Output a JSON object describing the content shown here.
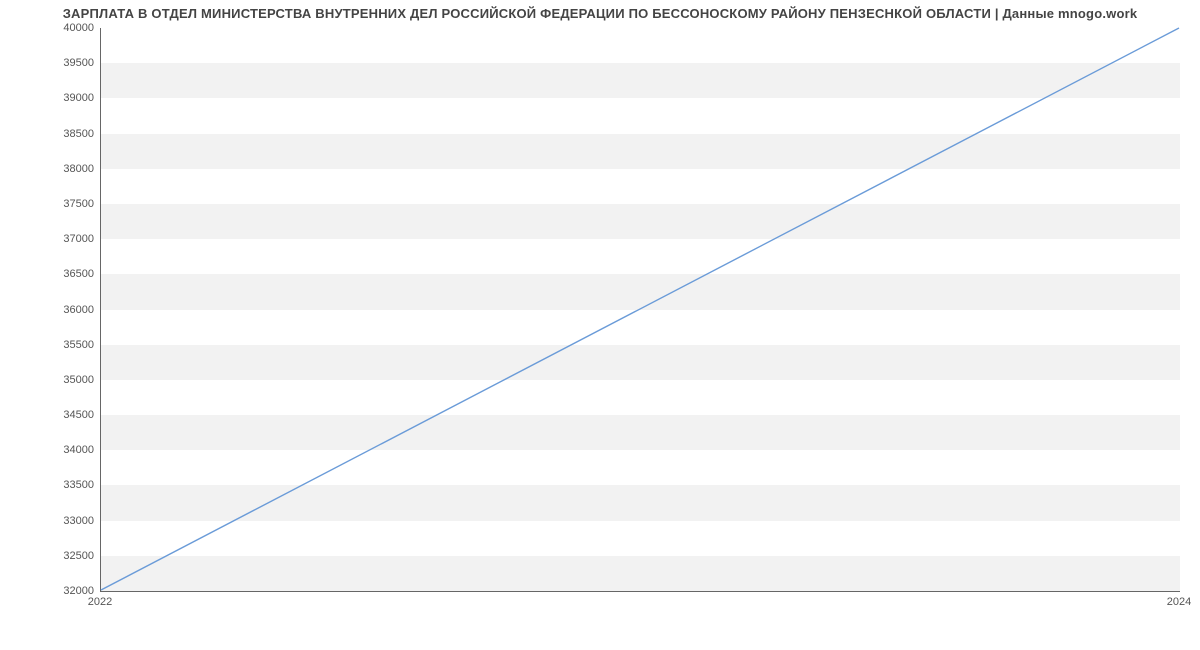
{
  "chart_data": {
    "type": "line",
    "title": "ЗАРПЛАТА В ОТДЕЛ МИНИСТЕРСТВА ВНУТРЕННИХ ДЕЛ РОССИЙСКОЙ ФЕДЕРАЦИИ ПО БЕССОНОСКОМУ РАЙОНУ ПЕНЗЕСНКОЙ ОБЛАСТИ | Данные mnogo.work",
    "xlabel": "",
    "ylabel": "",
    "x": [
      2022,
      2024
    ],
    "values": [
      32000,
      40000
    ],
    "xticks": [
      2022,
      2024
    ],
    "yticks": [
      32000,
      32500,
      33000,
      33500,
      34000,
      34500,
      35000,
      35500,
      36000,
      36500,
      37000,
      37500,
      38000,
      38500,
      39000,
      39500,
      40000
    ],
    "xlim": [
      2022,
      2024
    ],
    "ylim": [
      32000,
      40000
    ],
    "line_color": "#6a9bd8",
    "band_color": "#f2f2f2"
  }
}
